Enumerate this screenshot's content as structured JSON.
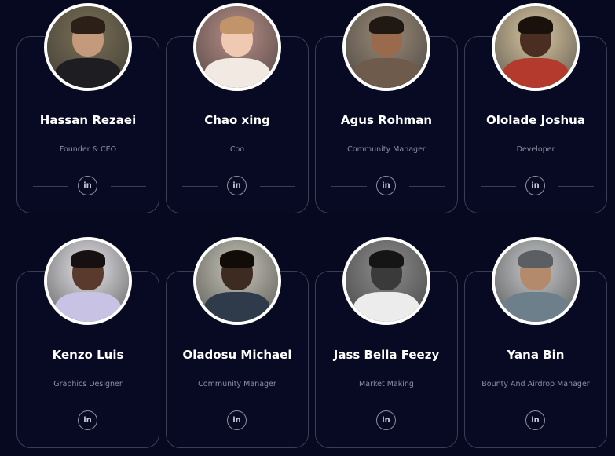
{
  "team": [
    {
      "name": "Hassan Rezaei",
      "role": "Founder & CEO",
      "social": "in",
      "photo": {
        "bg": "#7a6f55",
        "skin": "#c49a7c",
        "hair": "#2b1f18",
        "shirt": "#1d1d22"
      }
    },
    {
      "name": "Chao xing",
      "role": "Coo",
      "social": "in",
      "photo": {
        "bg": "#b78e87",
        "skin": "#efc9b2",
        "hair": "#c2946a",
        "shirt": "#f1e9e2"
      }
    },
    {
      "name": "Agus Rohman",
      "role": "Community Manager",
      "social": "in",
      "photo": {
        "bg": "#9a8a78",
        "skin": "#9a6a4c",
        "hair": "#1f1813",
        "shirt": "#6f5b4b"
      }
    },
    {
      "name": "Ololade Joshua",
      "role": "Developer",
      "social": "in",
      "photo": {
        "bg": "#d9c7a2",
        "skin": "#4a2e22",
        "hair": "#1a110c",
        "shirt": "#b43a2e"
      }
    },
    {
      "name": "Kenzo Luis",
      "role": "Graphics Designer",
      "social": "in",
      "photo": {
        "bg": "#e7e5ea",
        "skin": "#5a3a2c",
        "hair": "#161010",
        "shirt": "#c8c3e4"
      }
    },
    {
      "name": "Oladosu Michael",
      "role": "Community Manager",
      "social": "in",
      "photo": {
        "bg": "#c8c6b9",
        "skin": "#3d2a21",
        "hair": "#120c09",
        "shirt": "#2f3a4a"
      }
    },
    {
      "name": "Jass Bella Feezy",
      "role": "Market Making",
      "social": "in",
      "photo": {
        "bg": "#8c8c8c",
        "skin": "#3a3a3a",
        "hair": "#151515",
        "shirt": "#ececec"
      }
    },
    {
      "name": "Yana Bin",
      "role": "Bounty And Airdrop Manager",
      "social": "in",
      "photo": {
        "bg": "#c7c9cc",
        "skin": "#b48a6c",
        "hair": "#5b5e63",
        "shirt": "#6e7f8c"
      }
    }
  ]
}
